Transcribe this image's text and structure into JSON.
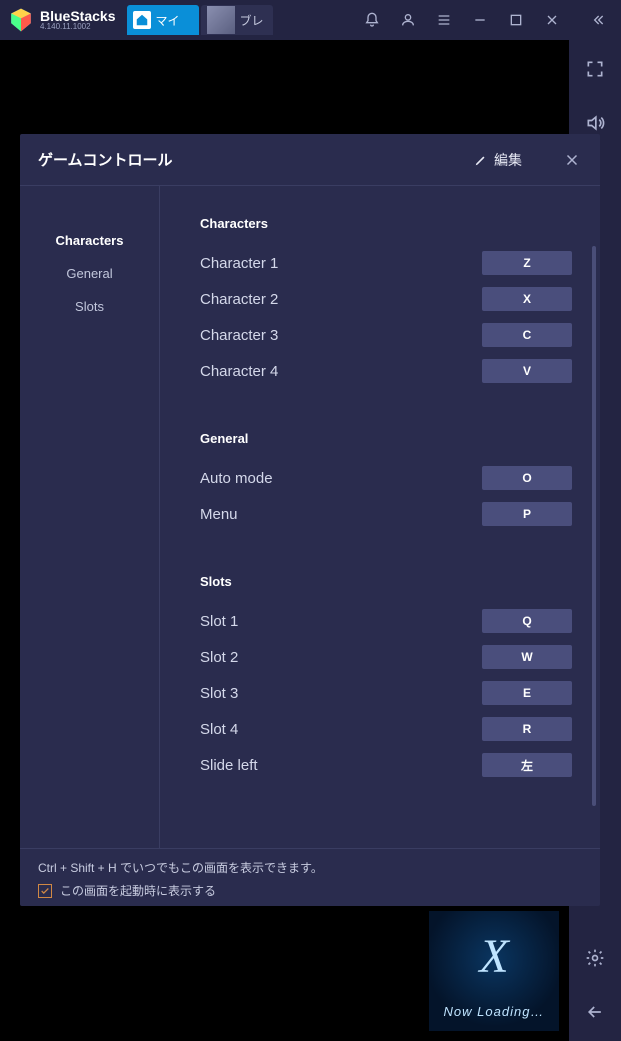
{
  "app": {
    "name": "BlueStacks",
    "version": "4.140.11.1002"
  },
  "tabs": [
    {
      "label": "マイ",
      "active": true
    },
    {
      "label": "ブレ",
      "active": false
    }
  ],
  "loading": {
    "glyph": "X",
    "text": "Now Loading…"
  },
  "modal": {
    "title": "ゲームコントロール",
    "edit_label": "編集",
    "sidebar_tabs": [
      {
        "label": "Characters",
        "active": true
      },
      {
        "label": "General",
        "active": false
      },
      {
        "label": "Slots",
        "active": false
      }
    ],
    "sections": [
      {
        "title": "Characters",
        "rows": [
          {
            "label": "Character 1",
            "key": "Z"
          },
          {
            "label": "Character 2",
            "key": "X"
          },
          {
            "label": "Character 3",
            "key": "C"
          },
          {
            "label": "Character 4",
            "key": "V"
          }
        ]
      },
      {
        "title": "General",
        "rows": [
          {
            "label": "Auto mode",
            "key": "O"
          },
          {
            "label": "Menu",
            "key": "P"
          }
        ]
      },
      {
        "title": "Slots",
        "rows": [
          {
            "label": "Slot 1",
            "key": "Q"
          },
          {
            "label": "Slot 2",
            "key": "W"
          },
          {
            "label": "Slot 3",
            "key": "E"
          },
          {
            "label": "Slot 4",
            "key": "R"
          },
          {
            "label": "Slide left",
            "key": "左"
          }
        ]
      }
    ],
    "footer": {
      "hint": "Ctrl + Shift + H でいつでもこの画面を表示できます。",
      "checkbox_label": "この画面を起動時に表示する",
      "checkbox_checked": true
    }
  }
}
